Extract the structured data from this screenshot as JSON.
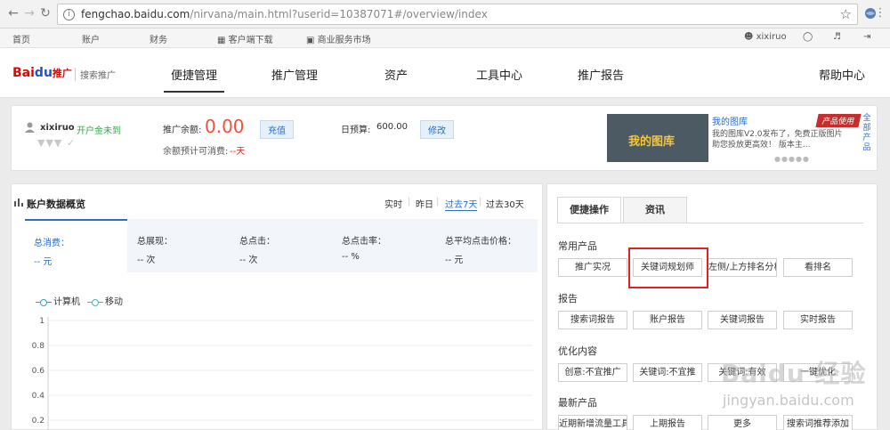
{
  "browser": {
    "url_host": "fengchao.baidu.com",
    "url_path": "/nirvana/main.html?userid=10387071#/overview/index"
  },
  "topbar": {
    "home": "首页",
    "account": "账户",
    "finance": "财务",
    "client_download": "客户端下载",
    "market": "商业服务市场",
    "username": "xixiruo"
  },
  "header": {
    "logo_bai": "Bai",
    "logo_du": "du",
    "logo_tg": "推广",
    "logo_sub": "搜索推广",
    "nav": [
      "便捷管理",
      "推广管理",
      "资产",
      "工具中心",
      "推广报告",
      "帮助中心"
    ]
  },
  "account": {
    "username": "xixiruo",
    "status": "开户金未到",
    "balance_label": "推广余额:",
    "balance_value": "0.00",
    "recharge": "充值",
    "days_label": "余额预计可消费:",
    "days_value": "--天",
    "budget_label": "日预算:",
    "budget_value": "600.00",
    "modify": "修改"
  },
  "ad": {
    "banner_text": "我的图库",
    "title": "我的图库",
    "tag": "产品使用",
    "desc1": "我的图库V2.0发布了，免费正版图片",
    "desc2": "助您投放更高效！ 版本主...",
    "side_link": "全部产品"
  },
  "overview": {
    "title": "账户数据概览",
    "ranges": [
      "实时",
      "昨日",
      "过去7天",
      "过去30天"
    ],
    "metrics": [
      {
        "label": "总消费：",
        "value": "-- 元"
      },
      {
        "label": "总展现：",
        "value": "-- 次"
      },
      {
        "label": "总点击：",
        "value": "-- 次"
      },
      {
        "label": "总点击率：",
        "value": "-- %"
      },
      {
        "label": "总平均点击价格：",
        "value": "-- 元"
      }
    ],
    "legend": [
      "计算机",
      "移动"
    ]
  },
  "chart_data": {
    "type": "line",
    "yticks": [
      "1",
      "0.8",
      "0.6",
      "0.4",
      "0.2"
    ],
    "ylim": [
      0,
      1
    ],
    "series": [
      {
        "name": "计算机",
        "values": []
      },
      {
        "name": "移动",
        "values": []
      }
    ],
    "grid": true
  },
  "quick": {
    "tabs": [
      "便捷操作",
      "资讯"
    ],
    "sections": [
      {
        "title": "常用产品",
        "buttons": [
          "推广实况",
          "关键词规划师",
          "左侧/上方排名分析",
          "看排名"
        ]
      },
      {
        "title": "报告",
        "buttons": [
          "搜索词报告",
          "账户报告",
          "关键词报告",
          "实时报告"
        ]
      },
      {
        "title": "优化内容",
        "buttons": [
          "创意:不宜推广",
          "关键词:不宜推",
          "关键词:有效",
          "一键优化"
        ]
      },
      {
        "title": "最新产品",
        "buttons": [
          "近期新增流量工具",
          "上期报告",
          "更多",
          "搜索词推荐添加"
        ]
      }
    ]
  },
  "watermark": {
    "main": "Baidu 经验",
    "sub": "jingyan.baidu.com"
  },
  "colors": {
    "accent": "#2a6ec6",
    "balance": "#f0503c",
    "highlight": "#e0231f"
  }
}
